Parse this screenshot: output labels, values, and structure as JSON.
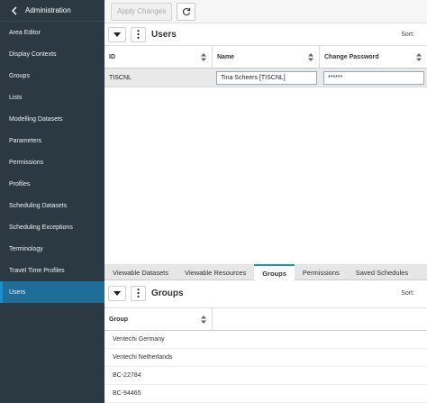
{
  "sidebar": {
    "header": "Administration",
    "items": [
      {
        "label": "Area Editor",
        "active": false
      },
      {
        "label": "Display Contexts",
        "active": false
      },
      {
        "label": "Groups",
        "active": false
      },
      {
        "label": "Lists",
        "active": false
      },
      {
        "label": "Modelling Datasets",
        "active": false
      },
      {
        "label": "Parameters",
        "active": false
      },
      {
        "label": "Permissions",
        "active": false
      },
      {
        "label": "Profiles",
        "active": false
      },
      {
        "label": "Scheduling Datasets",
        "active": false
      },
      {
        "label": "Scheduling Exceptions",
        "active": false
      },
      {
        "label": "Terminology",
        "active": false
      },
      {
        "label": "Travel Time Profiles",
        "active": false
      },
      {
        "label": "Users",
        "active": true
      }
    ]
  },
  "toolbar": {
    "apply_label": "Apply Changes"
  },
  "users": {
    "title": "Users",
    "sort_label": "Sort:",
    "columns": [
      "ID",
      "Name",
      "Change Password"
    ],
    "rows": [
      {
        "id": "TISCNL",
        "name": "Tina Scheers [TISCNL]",
        "password": "******"
      }
    ]
  },
  "tabs": [
    {
      "label": "Viewable Datasets",
      "active": false
    },
    {
      "label": "Viewable Resources",
      "active": false
    },
    {
      "label": "Groups",
      "active": true
    },
    {
      "label": "Permissions",
      "active": false
    },
    {
      "label": "Saved Schedules",
      "active": false
    }
  ],
  "groups": {
    "title": "Groups",
    "sort_label": "Sort:",
    "column": "Group",
    "rows": [
      "Ventechi Germany",
      "Ventechi Netherlands",
      "BC-22784",
      "BC-94465"
    ]
  },
  "colors": {
    "sidebar_bg": "#2b3a42",
    "active_item": "#1f6e9a",
    "accent": "#1a8fd0"
  }
}
